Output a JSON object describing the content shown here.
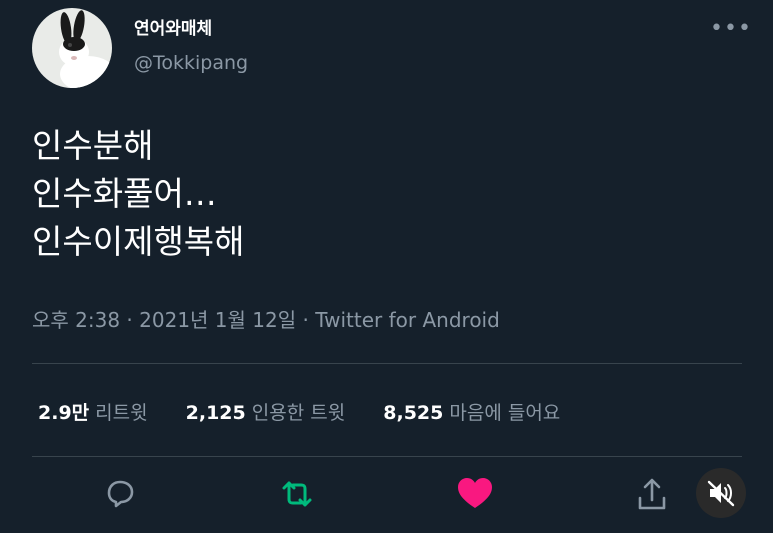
{
  "author": {
    "display_name": "연어와매체",
    "handle": "@Tokkipang"
  },
  "tweet": {
    "lines": [
      "인수분해",
      "인수화풀어…",
      "인수이제행복해"
    ],
    "time": "오후 2:38",
    "date": "2021년 1월 12일",
    "separator": " · ",
    "source": "Twitter for Android"
  },
  "stats": {
    "retweets_value": "2.9만",
    "retweets_label": "리트윗",
    "quotes_value": "2,125",
    "quotes_label": "인용한 트윗",
    "likes_value": "8,525",
    "likes_label": "마음에 들어요"
  },
  "icons": {
    "reply": "reply-icon",
    "retweet": "retweet-icon",
    "like": "heart-icon",
    "share": "share-icon",
    "mute": "speaker-muted-icon",
    "more": "more-icon"
  },
  "colors": {
    "background": "#15202b",
    "retweet": "#00ba7c",
    "like": "#f91880",
    "muted_text": "#8b98a5"
  }
}
